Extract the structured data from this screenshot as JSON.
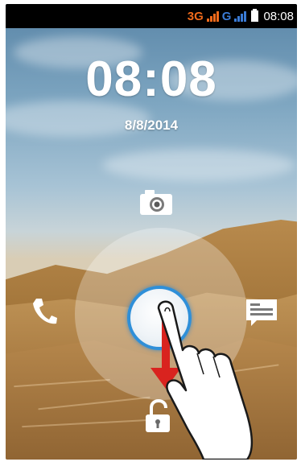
{
  "status_bar": {
    "network_3g": "3G",
    "network_g": "G",
    "time": "08:08",
    "colors": {
      "network_3g": "#f06a1b",
      "network_g": "#3a7bd5"
    },
    "icons": [
      "signal-bars-icon",
      "battery-icon"
    ]
  },
  "lockscreen": {
    "clock": "08:08",
    "date": "8/8/2014",
    "targets": [
      {
        "name": "camera",
        "icon": "camera-icon"
      },
      {
        "name": "phone",
        "icon": "phone-icon"
      },
      {
        "name": "message",
        "icon": "message-icon"
      },
      {
        "name": "unlock",
        "icon": "unlock-icon"
      }
    ],
    "handle_icon": "unlock-handle",
    "gesture": {
      "direction": "down",
      "icons": [
        "arrow-down-icon",
        "hand-pointer-icon"
      ]
    },
    "colors": {
      "handle_ring": "#2f8fd8",
      "arrow": "#d9231f"
    }
  }
}
